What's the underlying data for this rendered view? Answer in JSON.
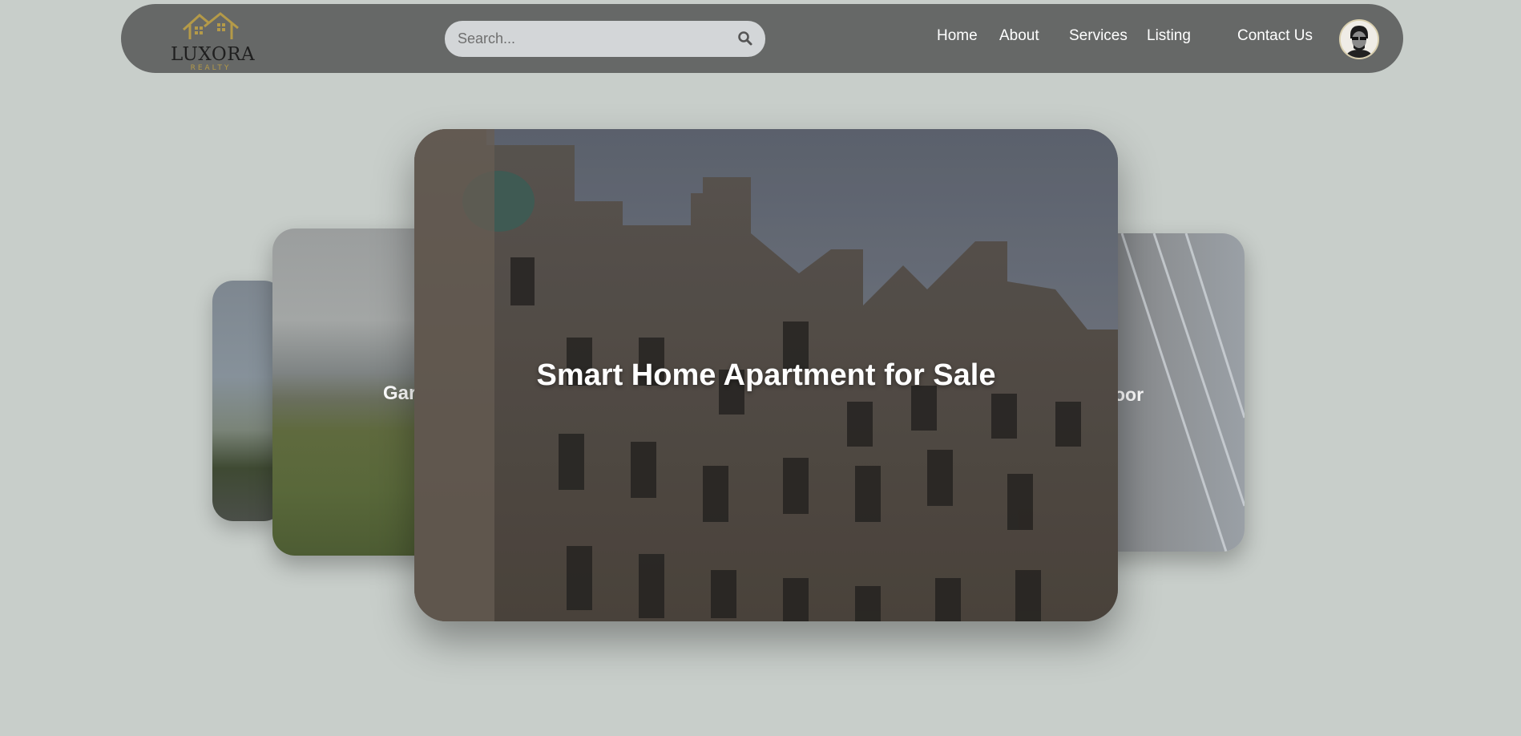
{
  "header": {
    "logo": {
      "name": "LUXORA",
      "tagline": "REALTY"
    },
    "search": {
      "placeholder": "Search...",
      "value": ""
    },
    "nav": [
      {
        "label": "Home"
      },
      {
        "label": "About"
      },
      {
        "label": "Services"
      },
      {
        "label": "Listing"
      },
      {
        "label": "Contact Us"
      }
    ]
  },
  "carousel": {
    "cards": [
      {
        "title": ""
      },
      {
        "title": "Gar"
      },
      {
        "title": "Smart Home Apartment for Sale"
      },
      {
        "title": "oor"
      }
    ]
  },
  "colors": {
    "background": "#c8ceca",
    "navbar": "#666867",
    "logo_gold": "#b49a48"
  }
}
